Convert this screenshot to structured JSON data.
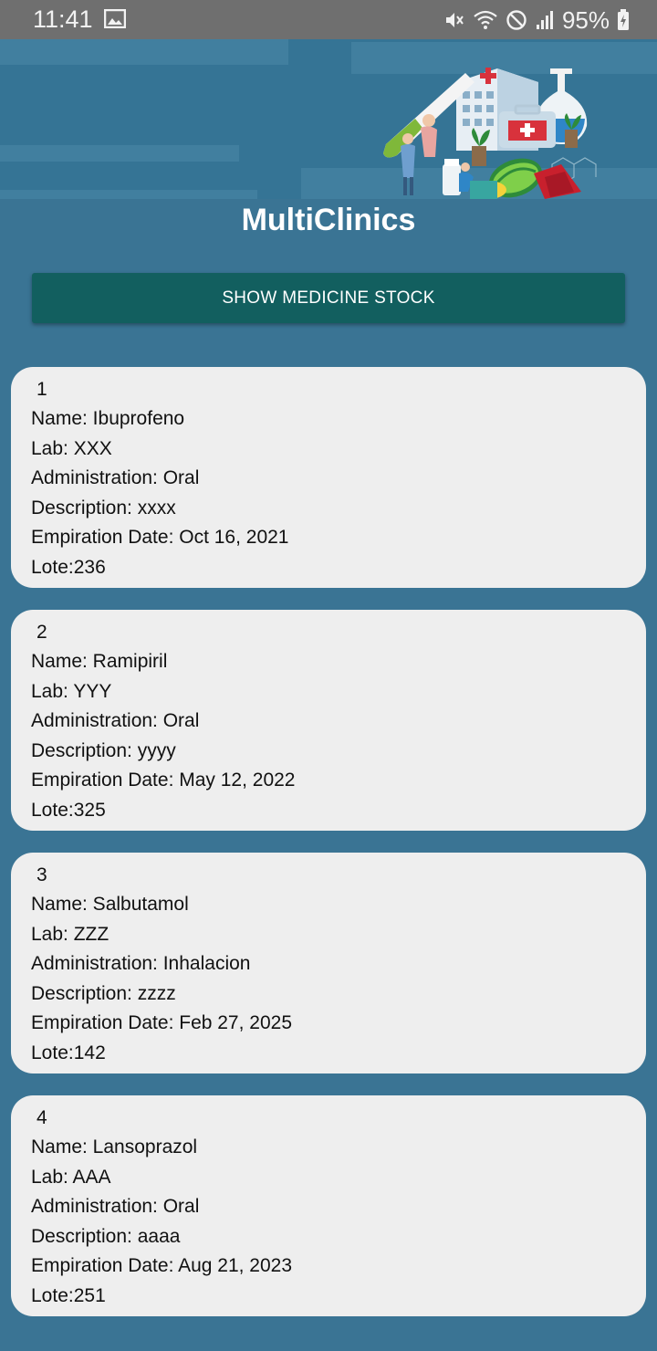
{
  "status_bar": {
    "time": "11:41",
    "battery": "95%"
  },
  "app": {
    "title": "MultiClinics"
  },
  "actions": {
    "show_stock_label": "SHOW MEDICINE STOCK"
  },
  "medicines": [
    {
      "index": "1",
      "name": "Name: Ibuprofeno",
      "lab": "Lab: XXX",
      "administration": "Administration: Oral",
      "description": "Description: xxxx",
      "expiration": "Empiration Date: Oct 16, 2021",
      "lote": "Lote:236"
    },
    {
      "index": "2",
      "name": "Name: Ramipiril",
      "lab": "Lab: YYY",
      "administration": "Administration: Oral",
      "description": "Description: yyyy",
      "expiration": "Empiration Date: May 12, 2022",
      "lote": "Lote:325"
    },
    {
      "index": "3",
      "name": "Name: Salbutamol",
      "lab": "Lab: ZZZ",
      "administration": "Administration: Inhalacion",
      "description": "Description: zzzz",
      "expiration": "Empiration Date: Feb 27, 2025",
      "lote": "Lote:142"
    },
    {
      "index": "4",
      "name": "Name: Lansoprazol",
      "lab": "Lab: AAA",
      "administration": "Administration: Oral",
      "description": "Description: aaaa",
      "expiration": "Empiration Date: Aug 21, 2023",
      "lote": "Lote:251"
    }
  ]
}
